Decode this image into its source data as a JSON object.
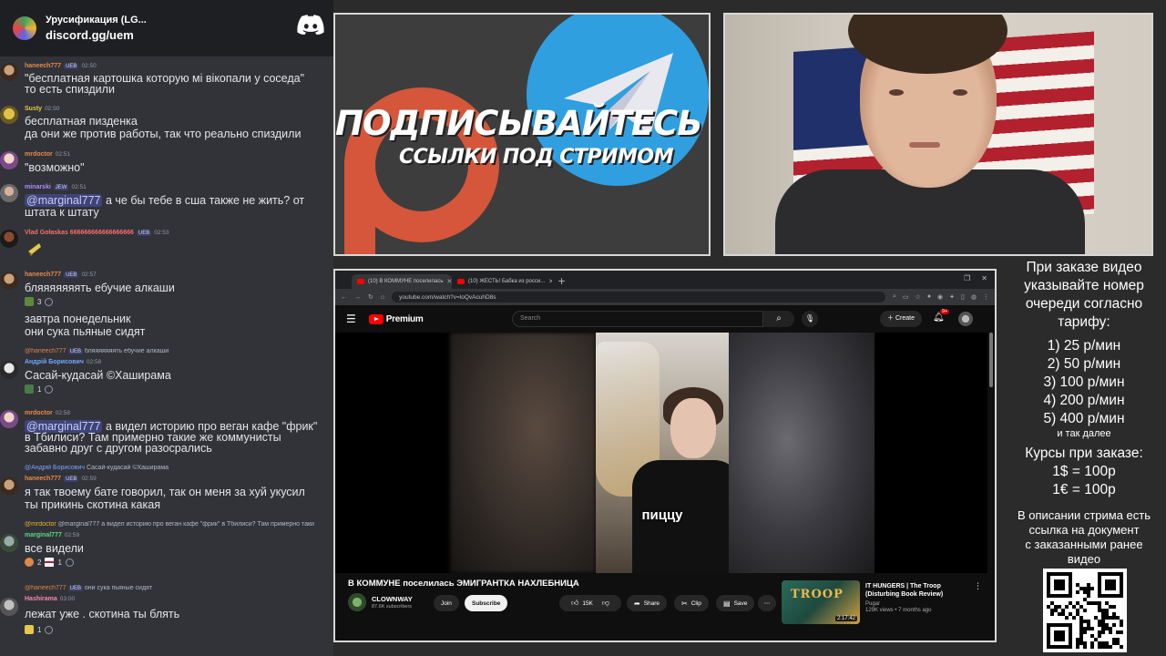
{
  "chat": {
    "server_name": "Урусификация (LG...",
    "invite": "discord.gg/uem",
    "messages": [
      {
        "user": "haneech777",
        "badge": "UEB",
        "time": "02:50",
        "lines": [
          "\"бесплатная картошка которую мі вікопали у соседа\"",
          "то есть спиздили"
        ]
      },
      {
        "user": "Susty",
        "time": "02:50",
        "lines": [
          "бесплатная пизденка",
          "да они же против работы, так что реально спиздили"
        ]
      },
      {
        "user": "mrdoctor",
        "time": "02:51",
        "lines": [
          "\"возможно\""
        ]
      },
      {
        "user": "minarski",
        "badge": "JEW",
        "time": "02:51",
        "mention": "@marginal777",
        "lines": [
          " а че бы тебе в сша также не жить? от",
          "штата к штату"
        ]
      },
      {
        "user": "Vlad Gołaskas 666666666666666666",
        "badge": "UEB",
        "time": "02:53",
        "lines": []
      },
      {
        "user": "haneech777",
        "badge": "UEB",
        "time": "02:57",
        "lines": [
          "бляяяяяяять ебучие алкаши"
        ],
        "reaction_count": "3"
      },
      {
        "lines": [
          "завтра понедельник",
          "они сука пьяные сидят"
        ]
      },
      {
        "reply_user": "@haneech777",
        "reply_badge": "UEB",
        "reply_text": "бляяяяяяять ебучие алкаши",
        "user": "Андрій Борисович",
        "time": "02:58",
        "lines": [
          "Сасай-кудасай ©Хаширама"
        ],
        "reaction_count": "1"
      },
      {
        "user": "mrdoctor",
        "time": "02:58",
        "mention": "@marginal777",
        "lines": [
          " а видел историю про веган кафе \"фрик\"",
          "в Тбилиси? Там примерно такие же коммунисты",
          "забавно друг с другом разосрались"
        ]
      },
      {
        "reply_user": "@Андрій Борисович",
        "reply_text": "Сасай-кудасай ©Хаширама",
        "user": "haneech777",
        "badge": "UEB",
        "time": "02:59",
        "lines": [
          "я так твоему бате говорил, так он меня за хуй укусил",
          "ты прикинь скотина какая"
        ]
      },
      {
        "reply_user": "@mrdoctor",
        "reply_text": "@marginal777 а видел историю про веган кафе \"фрик\" в Тбилиси? Там примерно таки",
        "user": "marginal777",
        "time": "02:59",
        "lines": [
          "все видели"
        ],
        "reactions": [
          "2",
          "1"
        ]
      },
      {
        "reply_user": "@haneech777",
        "reply_badge": "UEB",
        "reply_text": "они сука пьяные сидят",
        "user": "Hashirama",
        "time": "03:00",
        "lines": [
          "лежат уже . скотина ты блять"
        ],
        "reaction_count": "1"
      }
    ]
  },
  "banner": {
    "line1": "ПОДПИСЫВАЙТЕСЬ",
    "line2": "ССЫЛКИ ПОД СТРИМОМ",
    "colors": {
      "telegram": "#2f9fe0",
      "p_logo": "#d5563a"
    }
  },
  "browser": {
    "tabs": [
      {
        "label": "(10) В КОММУНЕ поселилась"
      },
      {
        "label": "(10) ЖЕСТЬ! Бабка из росси..."
      }
    ],
    "url": "youtube.com/watch?v=loQvAcuhD8s",
    "youtube": {
      "logo_text": "Premium",
      "search_placeholder": "Search",
      "create_label": "Create",
      "notif_count": "9+",
      "subtitle": "пиццу",
      "video_title": "В КОММУНЕ поселилась ЭМИГРАНТКА НАХЛЕБНИЦА",
      "channel_name": "CLOWNWAY",
      "channel_subs": "87.6K subscribers",
      "join_label": "Join",
      "subscribe_label": "Subscribe",
      "like_count": "15K",
      "share_label": "Share",
      "clip_label": "Clip",
      "save_label": "Save",
      "rec": {
        "thumb_text": "TROOP",
        "duration": "2:17:42",
        "title": "IT HUNGERS | The Troop (Disturbing Book Review)",
        "channel": "Pugar",
        "views": "129K views • 7 months ago"
      }
    }
  },
  "info_panel": {
    "order_text": [
      "При заказе видео",
      "указывайте номер",
      "очереди согласно",
      "тарифу:"
    ],
    "tariffs": [
      "1) 25 р/мин",
      "2) 50 р/мин",
      "3) 100 р/мин",
      "4) 200 р/мин",
      "5) 400 р/мин"
    ],
    "and_more": "и так далее",
    "rates_title": "Курсы при заказе:",
    "rates": [
      "1$ = 100р",
      "1€ = 100р"
    ],
    "description": [
      "В описании стрима есть",
      "ссылка на документ",
      "с заказанными ранее",
      "видео"
    ]
  }
}
